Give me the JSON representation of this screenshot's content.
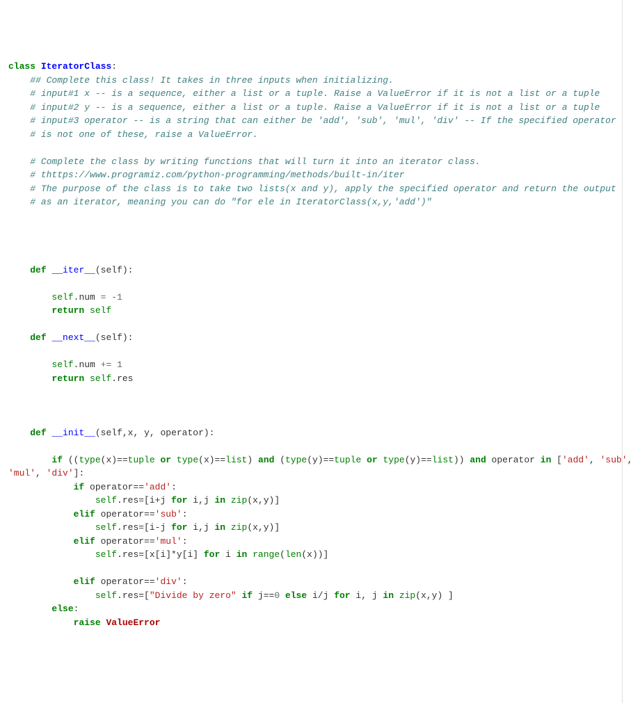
{
  "l1a": "class",
  "l1b": "IteratorClass",
  "l1c": ":",
  "l2": "## Complete this class! It takes in three inputs when initializing.",
  "l3": "# input#1 x -- is a sequence, either a list or a tuple. Raise a ValueError if it is not a list or a tuple",
  "l4": "# input#2 y -- is a sequence, either a list or a tuple. Raise a ValueError if it is not a list or a tuple",
  "l5": "# input#3 operator -- is a string that can either be 'add', 'sub', 'mul', 'div' -- If the specified operator",
  "l6": "# is not one of these, raise a ValueError.",
  "l7": "# Complete the class by writing functions that will turn it into an iterator class.",
  "l8": "# thttps://www.programiz.com/python-programming/methods/built-in/iter",
  "l9": "# The purpose of the class is to take two lists(x and y), apply the specified operator and return the output",
  "l10": "# as an iterator, meaning you can do \"for ele in IteratorClass(x,y,'add')\"",
  "def": "def",
  "iter_name": "__iter__",
  "next_name": "__next__",
  "init_name": "__init__",
  "self_lbl": "self",
  "return": "return",
  "if": "if",
  "elif": "elif",
  "else": "else",
  "for": "for",
  "in": "in",
  "or": "or",
  "and": "and",
  "raise": "raise",
  "type": "type",
  "tuple": "tuple",
  "list": "list",
  "range": "range",
  "len": "len",
  "zip": "zip",
  "num_m1": "1",
  "num_1": "1",
  "num_0": "0",
  "s_add": "'add'",
  "s_sub": "'sub'",
  "s_mul": "'mul'",
  "s_div": "'div'",
  "s_dbz": "\"Divide by zero\"",
  "verr": "ValueError",
  "p_self": "(self):",
  "p_init": "(self,x, y, operator):",
  "txt_selfnum": ".num ",
  "txt_dot_res": ".res",
  "txt_eq_m": "= -",
  "txt_pe": "+= ",
  "txt_dotres_eq": ".res=[i+j ",
  "txt_dot_res_eq_sub": ".res=[i-j ",
  "txt_dot_res_eq_mul": ".res=[x[i]*y[i] ",
  "txt_dot_res_eq_div": ".res=[",
  "txt_ij": " i,j ",
  "txt_ij2": " i, j ",
  "txt_i": " i ",
  "txt_zip_xy": "(x,y)]",
  "txt_zip_xy2": "(x,y) ]",
  "txt_range_len": "(x))]",
  "txt_if_j0": " j==",
  "txt_else_ij": " i/j ",
  "txt_operator_eq": " operator==",
  "txt_operator_in": " operator ",
  "txt_li_open": " [",
  "txt_comma": ", ",
  "txt_close_colon": "]:",
  "txt_type_x": "(x)==",
  "txt_type_y": "(y)==",
  "txt_open2": " ((",
  "txt_close2": ")) ",
  "txt_open1": " (",
  "txt_close1": ") ",
  "txt_colon": ":",
  "txt_open_paren": "("
}
